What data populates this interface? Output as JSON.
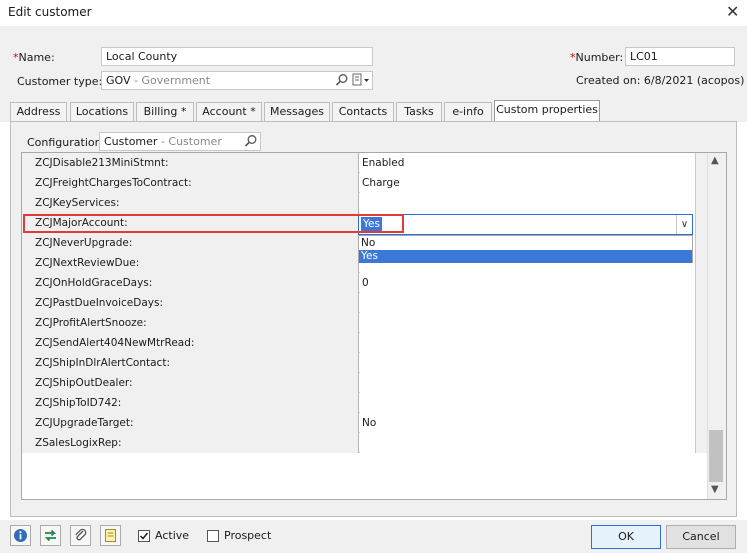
{
  "window": {
    "title": "Edit customer",
    "close_glyph": "✕"
  },
  "header": {
    "name_label": "Name:",
    "name_value": "Local County",
    "customer_type_label": "Customer type:",
    "customer_type_code": "GOV",
    "customer_type_desc": "- Government",
    "number_label": "Number:",
    "number_value": "LC01",
    "created_on": "Created on: 6/8/2021 (acopos)",
    "required_mark": "*"
  },
  "tabs": [
    {
      "label": "Address"
    },
    {
      "label": "Locations"
    },
    {
      "label": "Billing *"
    },
    {
      "label": "Account *"
    },
    {
      "label": "Messages"
    },
    {
      "label": "Contacts"
    },
    {
      "label": "Tasks"
    },
    {
      "label": "e-info"
    },
    {
      "label": "Custom properties",
      "active": true
    }
  ],
  "configuration": {
    "label": "Configuration:",
    "code": "Customer",
    "desc": "- Customer"
  },
  "properties": [
    {
      "name": "ZCJDisable213MiniStmnt:",
      "value": "Enabled"
    },
    {
      "name": "ZCJFreightChargesToContract:",
      "value": "Charge"
    },
    {
      "name": "ZCJKeyServices:",
      "value": ""
    },
    {
      "name": "ZCJMajorAccount:",
      "value": "Yes"
    },
    {
      "name": "ZCJNeverUpgrade:",
      "value": ""
    },
    {
      "name": "ZCJNextReviewDue:",
      "value": ""
    },
    {
      "name": "ZCJOnHoldGraceDays:",
      "value": "0"
    },
    {
      "name": "ZCJPastDueInvoiceDays:",
      "value": ""
    },
    {
      "name": "ZCJProfitAlertSnooze:",
      "value": ""
    },
    {
      "name": "ZCJSendAlert404NewMtrRead:",
      "value": ""
    },
    {
      "name": "ZCJShipInDlrAlertContact:",
      "value": ""
    },
    {
      "name": "ZCJShipOutDealer:",
      "value": ""
    },
    {
      "name": "ZCJShipToID742:",
      "value": ""
    },
    {
      "name": "ZCJUpgradeTarget:",
      "value": "No"
    },
    {
      "name": "ZSalesLogixRep:",
      "value": ""
    }
  ],
  "dropdown": {
    "selected": "Yes",
    "options": [
      {
        "label": "No"
      },
      {
        "label": "Yes",
        "selected": true
      }
    ]
  },
  "footer": {
    "active_label": "Active",
    "active_checked": true,
    "prospect_label": "Prospect",
    "prospect_checked": false,
    "ok_label": "OK",
    "cancel_label": "Cancel"
  },
  "colors": {
    "accent": "#3b78d8",
    "highlight": "#e03a3a",
    "required": "#d00000"
  },
  "icons": [
    "search-icon",
    "dropdown-picker-icon",
    "info-icon",
    "refresh-icon",
    "attach-icon",
    "notes-icon",
    "check-icon",
    "chevron-up-icon",
    "chevron-down-icon"
  ]
}
